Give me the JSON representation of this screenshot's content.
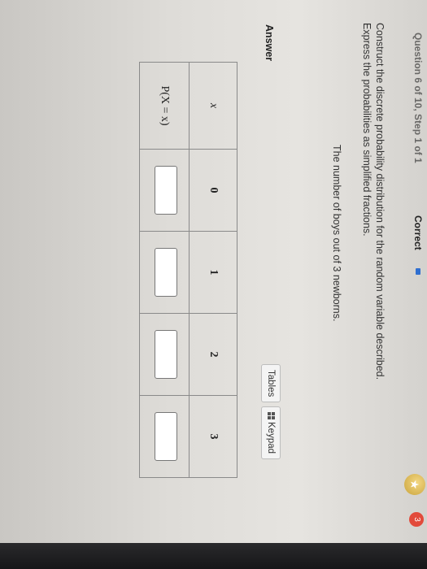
{
  "header": {
    "question_label": "Question 6 of 10, Step 1 of 1",
    "status": "Correct",
    "star_count": "3"
  },
  "prompt": {
    "instructions": "Construct the discrete probability distribution for the random variable described. Express the probabilities as simplified fractions.",
    "variable": "The number of boys out of 3 newborns."
  },
  "answer": {
    "label": "Answer",
    "tables_button": "Tables",
    "keypad_button": "Keypad"
  },
  "table": {
    "row_x_label": "x",
    "row_p_label": "P(X = x)",
    "columns": [
      "0",
      "1",
      "2",
      "3"
    ],
    "answers": [
      "",
      "",
      "",
      ""
    ]
  },
  "colors": {
    "status_accent": "#2f6fd0",
    "badge": "#e24a3b"
  }
}
